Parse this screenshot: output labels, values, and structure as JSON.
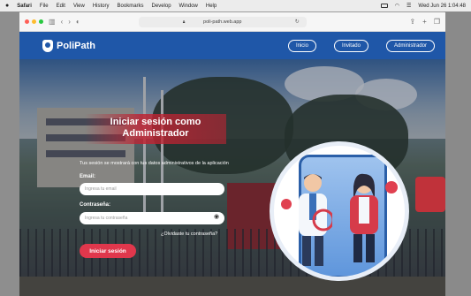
{
  "menubar": {
    "apple": "",
    "items": [
      "Safari",
      "File",
      "Edit",
      "View",
      "History",
      "Bookmarks",
      "Develop",
      "Window",
      "Help"
    ],
    "clock": "Wed Jun 26 1:04:48"
  },
  "browser": {
    "url": "poli-path.web.app"
  },
  "site": {
    "brand": "PoliPath",
    "nav": [
      "Inicio",
      "Invitado",
      "Administrador"
    ]
  },
  "login": {
    "title": "Iniciar sesión como Administrador",
    "subtitle": "Tus sesión se mostrará con tus datos administrativos de la aplicación",
    "email_label": "Email:",
    "email_placeholder": "Ingresa tu email",
    "password_label": "Contraseña:",
    "password_placeholder": "Ingresa tu contraseña",
    "forgot": "¿Olvidaste tu contraseña?",
    "submit": "Iniciar sesión"
  },
  "colors": {
    "header": "#1f57a8",
    "accent": "#e0374c"
  }
}
